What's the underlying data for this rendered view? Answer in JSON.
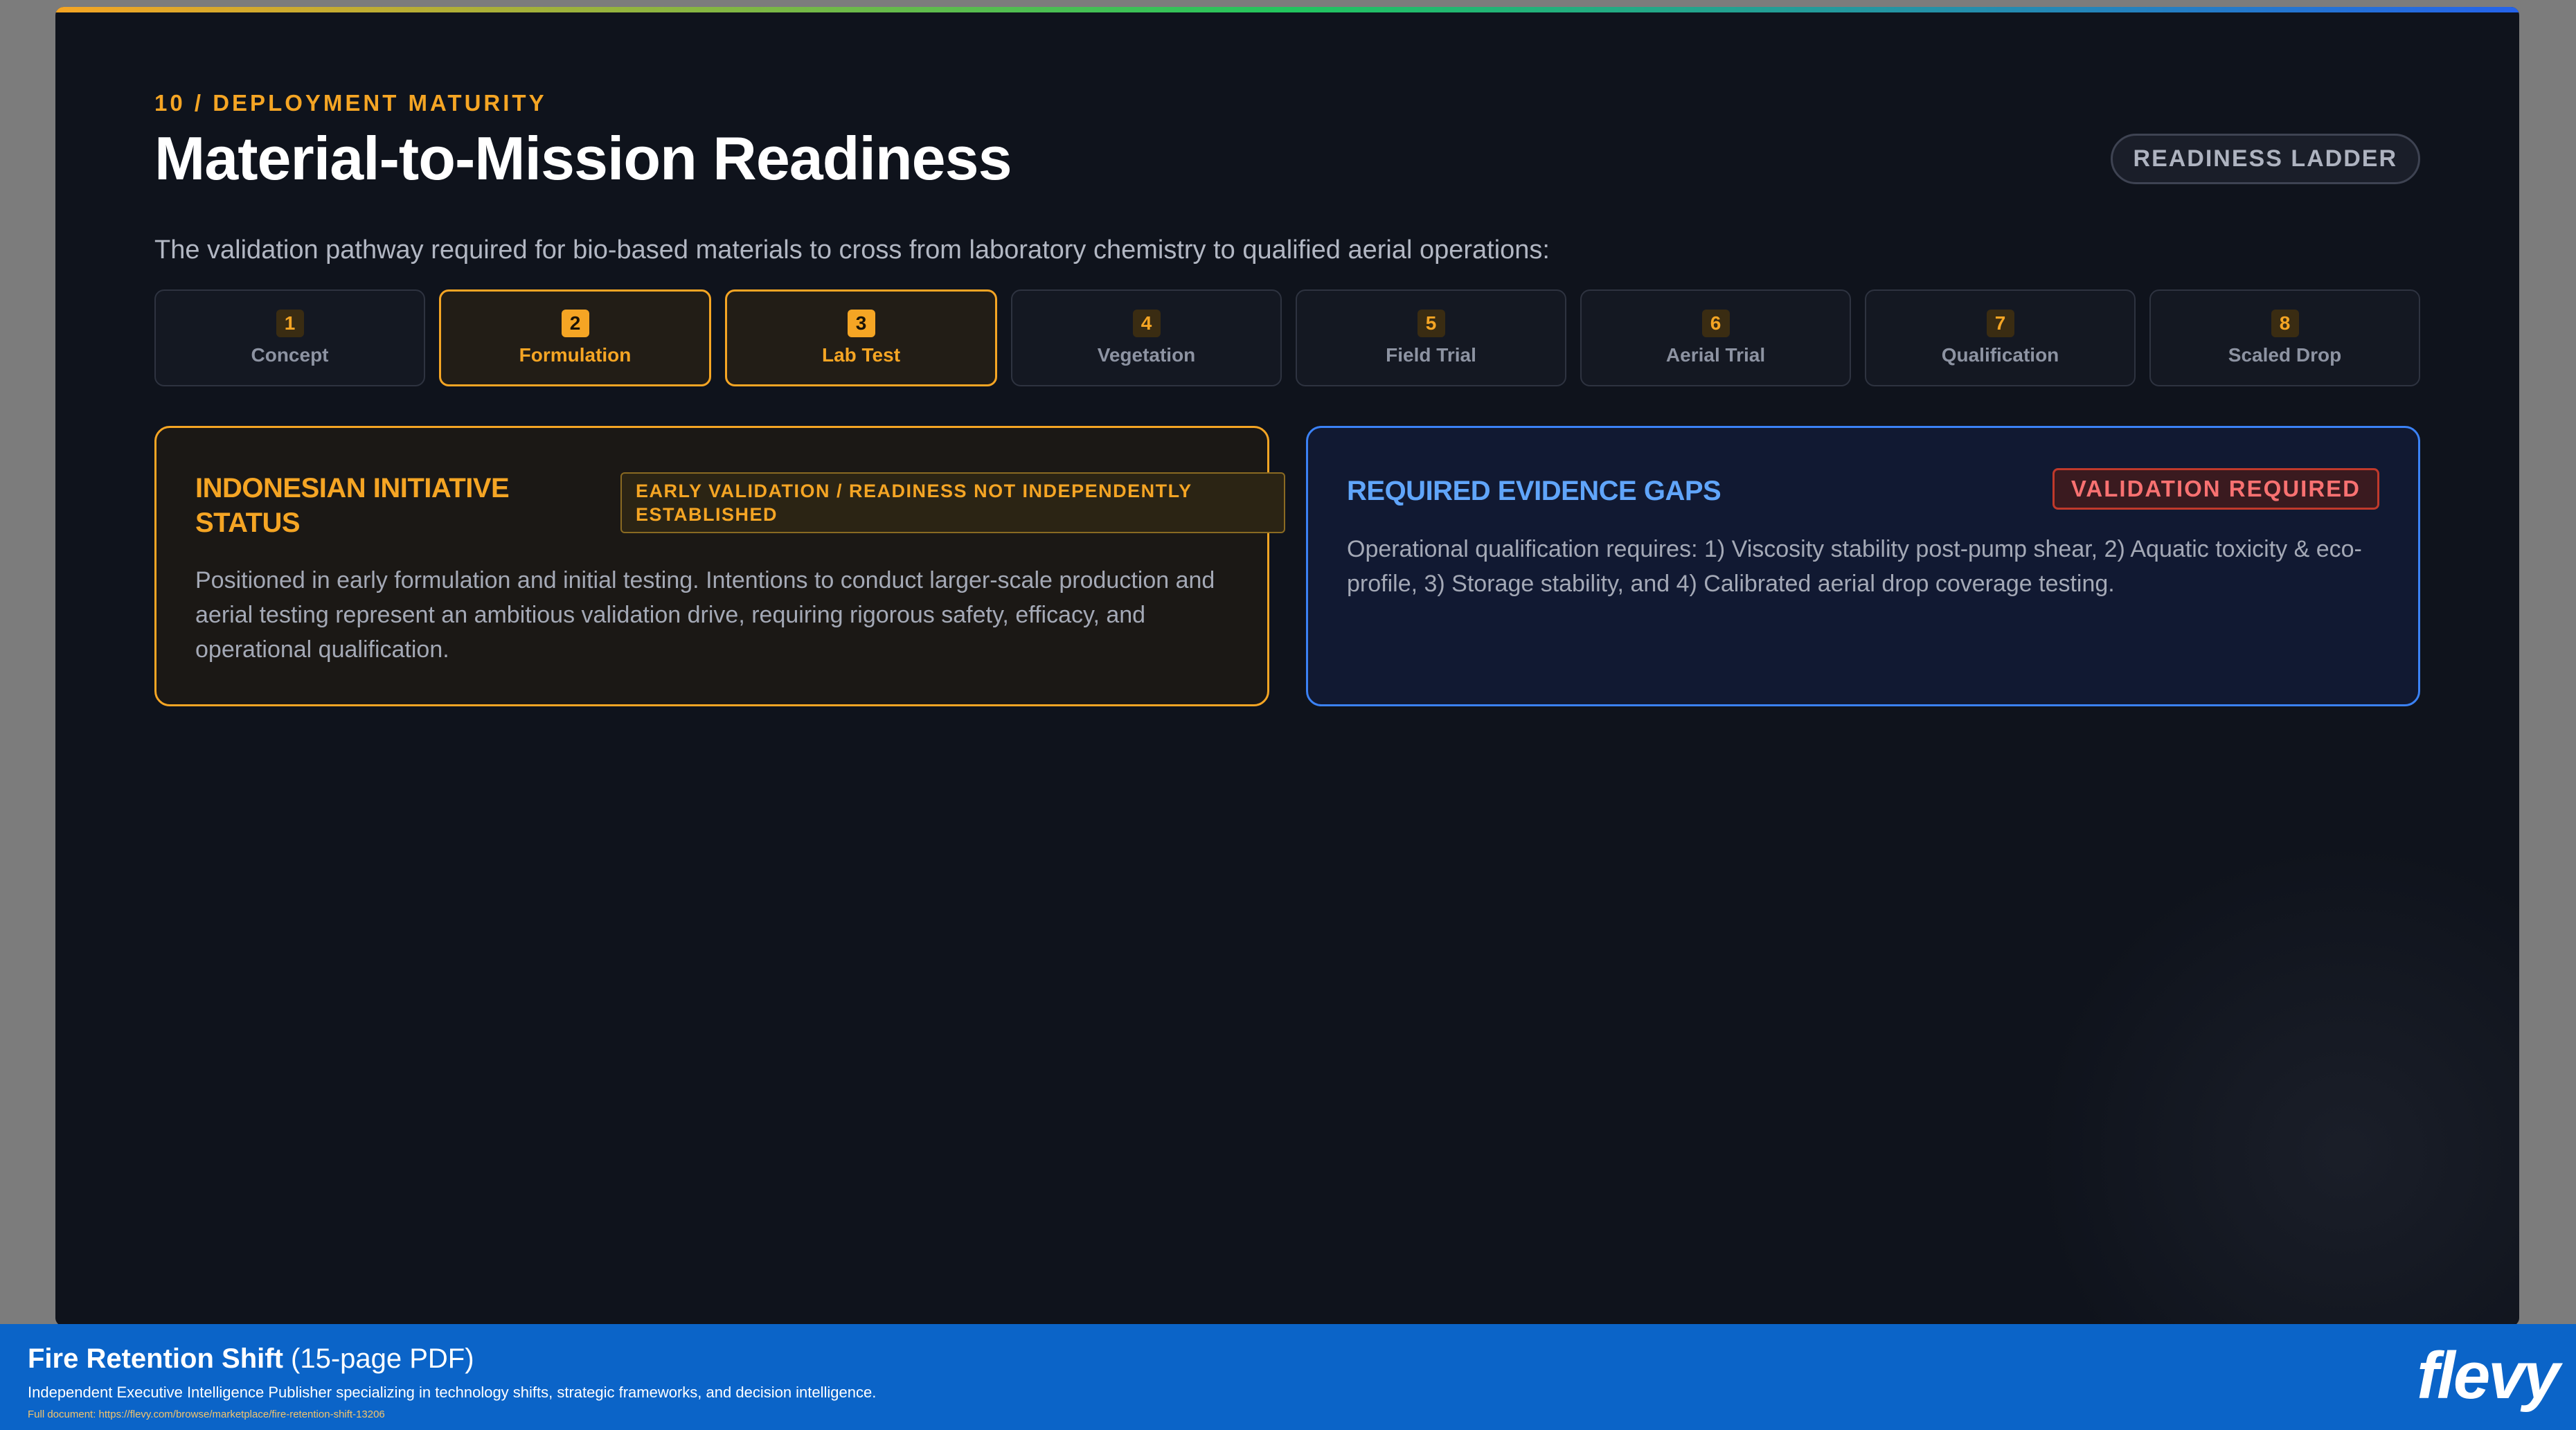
{
  "slide": {
    "eyebrow": "10 / DEPLOYMENT MATURITY",
    "title": "Material-to-Mission Readiness",
    "badge": "READINESS LADDER",
    "intro": "The validation pathway required for bio-based materials to cross from laboratory chemistry to qualified aerial operations:"
  },
  "steps": [
    {
      "num": "1",
      "label": "Concept",
      "active": false
    },
    {
      "num": "2",
      "label": "Formulation",
      "active": true
    },
    {
      "num": "3",
      "label": "Lab Test",
      "active": true
    },
    {
      "num": "4",
      "label": "Vegetation",
      "active": false
    },
    {
      "num": "5",
      "label": "Field Trial",
      "active": false
    },
    {
      "num": "6",
      "label": "Aerial Trial",
      "active": false
    },
    {
      "num": "7",
      "label": "Qualification",
      "active": false
    },
    {
      "num": "8",
      "label": "Scaled Drop",
      "active": false
    }
  ],
  "status_card": {
    "title": "INDONESIAN INITIATIVE STATUS",
    "tag": "EARLY VALIDATION / READINESS NOT INDEPENDENTLY ESTABLISHED",
    "body": "Positioned in early formulation and initial testing. Intentions to conduct larger-scale production and aerial testing represent an ambitious validation drive, requiring rigorous safety, efficacy, and operational qualification."
  },
  "gaps_card": {
    "title": "REQUIRED EVIDENCE GAPS",
    "tag": "VALIDATION REQUIRED",
    "body": "Operational qualification requires: 1) Viscosity stability post-pump shear, 2) Aquatic toxicity & eco-profile, 3) Storage stability, and 4) Calibrated aerial drop coverage testing."
  },
  "footer": {
    "title": "Fire Retention Shift",
    "title_suffix": " (15-page PDF)",
    "description": "Independent Executive Intelligence Publisher specializing in technology shifts, strategic frameworks, and decision intelligence.",
    "link": "Full document: https://flevy.com/browse/marketplace/fire-retention-shift-13206",
    "brand": "flevy"
  }
}
